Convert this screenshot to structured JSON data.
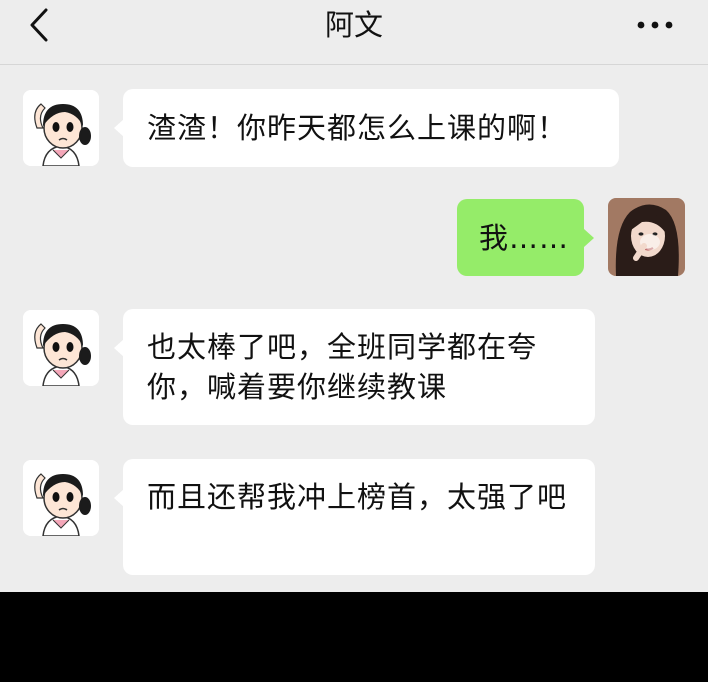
{
  "header": {
    "title": "阿文",
    "back_icon": "chevron-left-icon",
    "more_icon": "more-dots-icon"
  },
  "messages": [
    {
      "sender": "left",
      "avatar": "cartoon-girl-avatar",
      "text": "渣渣！你昨天都怎么上课的啊！"
    },
    {
      "sender": "right",
      "avatar": "photo-woman-avatar",
      "text": "我……"
    },
    {
      "sender": "left",
      "avatar": "cartoon-girl-avatar",
      "text": "也太棒了吧，全班同学都在夸你，喊着要你继续教课"
    },
    {
      "sender": "left",
      "avatar": "cartoon-girl-avatar",
      "text": "而且还帮我冲上榜首，太强了吧"
    }
  ],
  "colors": {
    "background": "#ededed",
    "incoming_bubble": "#ffffff",
    "outgoing_bubble": "#95ec69"
  }
}
